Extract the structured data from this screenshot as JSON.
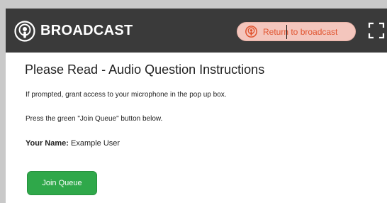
{
  "header": {
    "brand_icon": "podcast-icon",
    "title": "BROADCAST",
    "return_button": {
      "icon": "podcast-icon",
      "label": "Return to broadcast"
    },
    "fullscreen_icon": "expand-icon"
  },
  "content": {
    "heading": "Please Read - Audio Question Instructions",
    "instruction_1": "If prompted, grant access to your microphone in the pop up box.",
    "instruction_2": "Press the green \"Join Queue\" button below.",
    "name_label": "Your Name:",
    "name_value": "Example User",
    "join_button_label": "Join Queue"
  },
  "colors": {
    "header_bg": "#3a3a3a",
    "return_button_bg": "#f4c6bd",
    "return_button_text": "#e0542f",
    "join_button_bg": "#2fa84a"
  }
}
